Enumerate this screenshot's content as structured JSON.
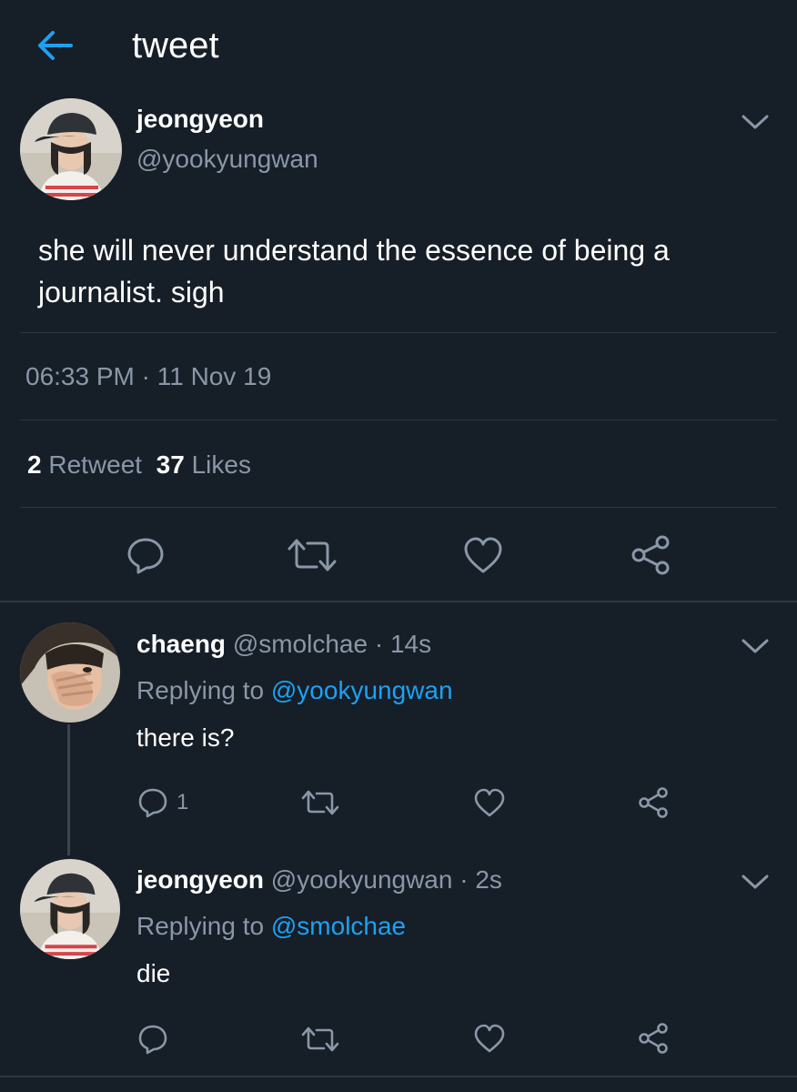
{
  "header": {
    "title": "tweet"
  },
  "main_tweet": {
    "name": "jeongyeon",
    "handle": "@yookyungwan",
    "text": "she will never understand the essence of being a journalist. sigh",
    "timestamp": "06:33 PM · 11 Nov 19",
    "retweets": "2",
    "retweets_label": "Retweet",
    "likes": "37",
    "likes_label": "Likes"
  },
  "replies": [
    {
      "name": "chaeng",
      "meta": "@smolchae · 14s",
      "replying_prefix": "Replying to",
      "replying_to": "@yookyungwan",
      "text": "there is?",
      "reply_count": "1"
    },
    {
      "name": "jeongyeon",
      "meta": "@yookyungwan · 2s",
      "replying_prefix": "Replying to",
      "replying_to": "@smolchae",
      "text": "die"
    }
  ],
  "colors": {
    "background": "#161e28",
    "accent": "#1da1f2",
    "muted_text": "#8a97a6",
    "divider": "#2c3744"
  },
  "icons": [
    "back-arrow-icon",
    "chevron-down-icon",
    "reply-icon",
    "retweet-icon",
    "like-icon",
    "share-icon"
  ]
}
